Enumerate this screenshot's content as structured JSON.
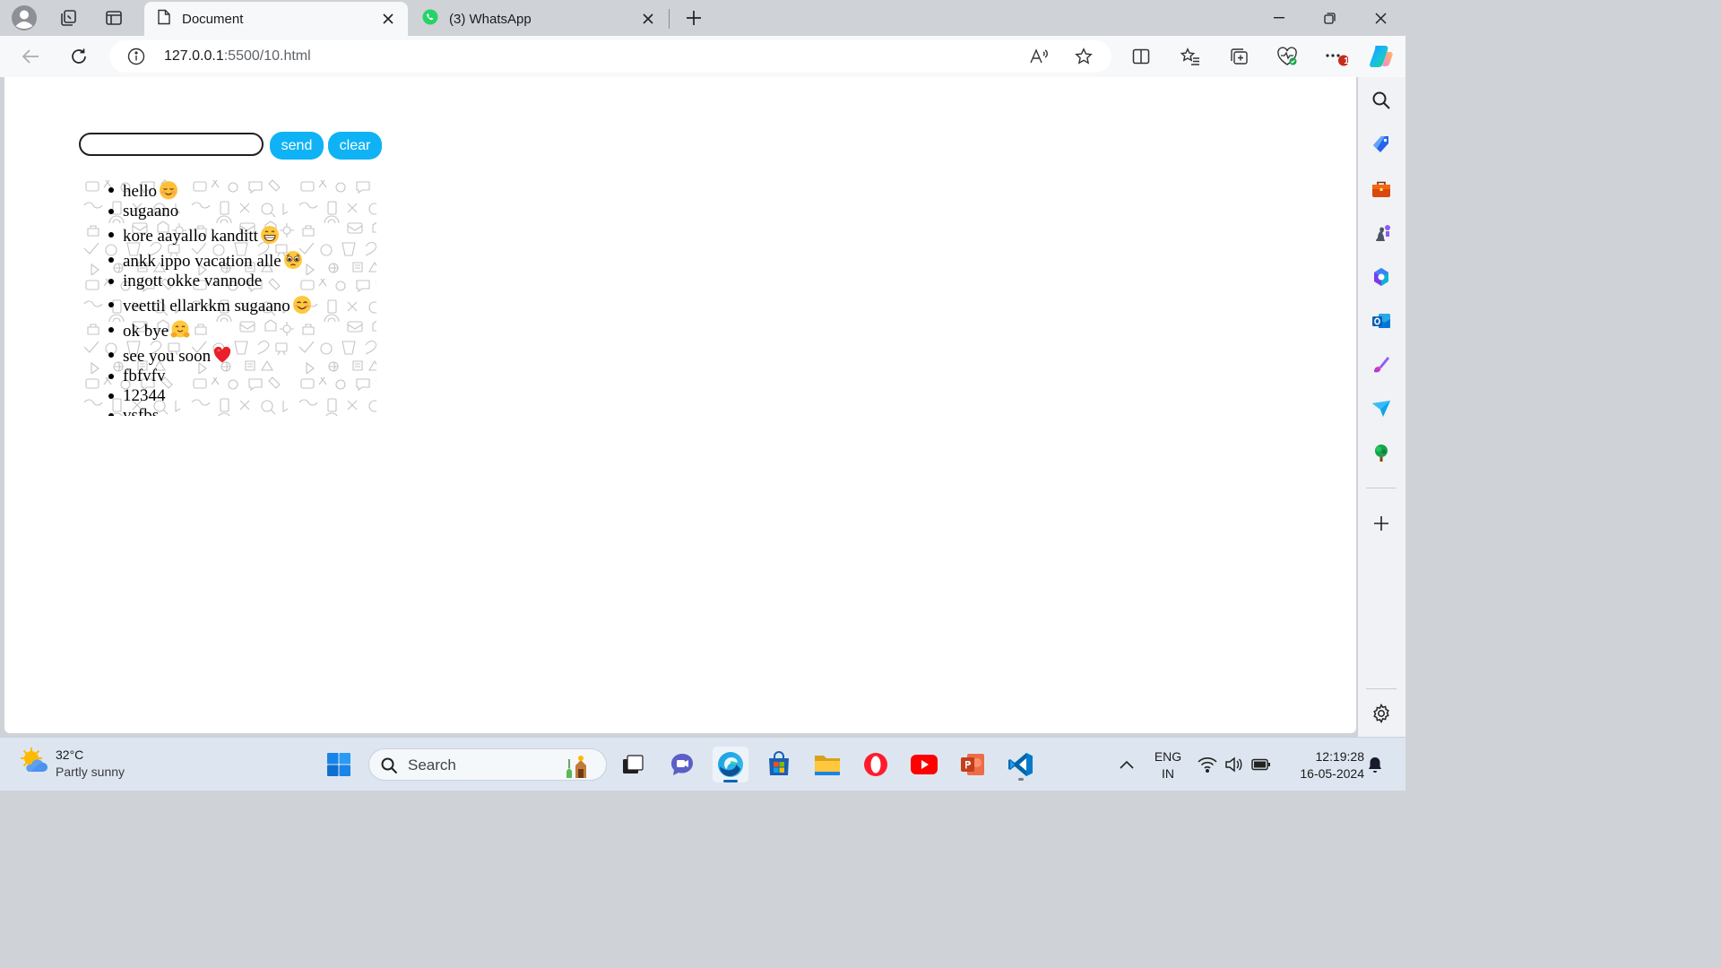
{
  "browser": {
    "tabs": [
      {
        "title": "Document",
        "active": true,
        "icon": "document-icon"
      },
      {
        "title": "(3) WhatsApp",
        "active": false,
        "icon": "whatsapp-icon"
      }
    ],
    "address": {
      "host": "127.0.0.1",
      "path": ":5500/10.html"
    },
    "notification_badge": "1"
  },
  "page": {
    "input_value": "",
    "send_label": "send",
    "clear_label": "clear",
    "messages": [
      {
        "text": "hello",
        "emoji": "relieved-face"
      },
      {
        "text": "sugaano",
        "emoji": ""
      },
      {
        "text": "kore aayallo kanditt",
        "emoji": "grinning-face"
      },
      {
        "text": "ankk ippo vacation alle",
        "emoji": "pleading-face"
      },
      {
        "text": "ingott okke vannode",
        "emoji": ""
      },
      {
        "text": "veettil ellarkkm sugaano",
        "emoji": "smiling-face"
      },
      {
        "text": "ok bye",
        "emoji": "hugging-face"
      },
      {
        "text": "see you soon",
        "emoji": "red-heart"
      },
      {
        "text": "fbfvfv",
        "emoji": ""
      },
      {
        "text": "12344",
        "emoji": ""
      },
      {
        "text": "vsfbs",
        "emoji": ""
      }
    ]
  },
  "colors": {
    "button_bg": "#0fb3f5",
    "button_text": "#ffffff"
  },
  "taskbar": {
    "weather_temp": "32°C",
    "weather_desc": "Partly sunny",
    "search_placeholder": "Search",
    "lang_line1": "ENG",
    "lang_line2": "IN",
    "time": "12:19:28",
    "date": "16-05-2024"
  }
}
